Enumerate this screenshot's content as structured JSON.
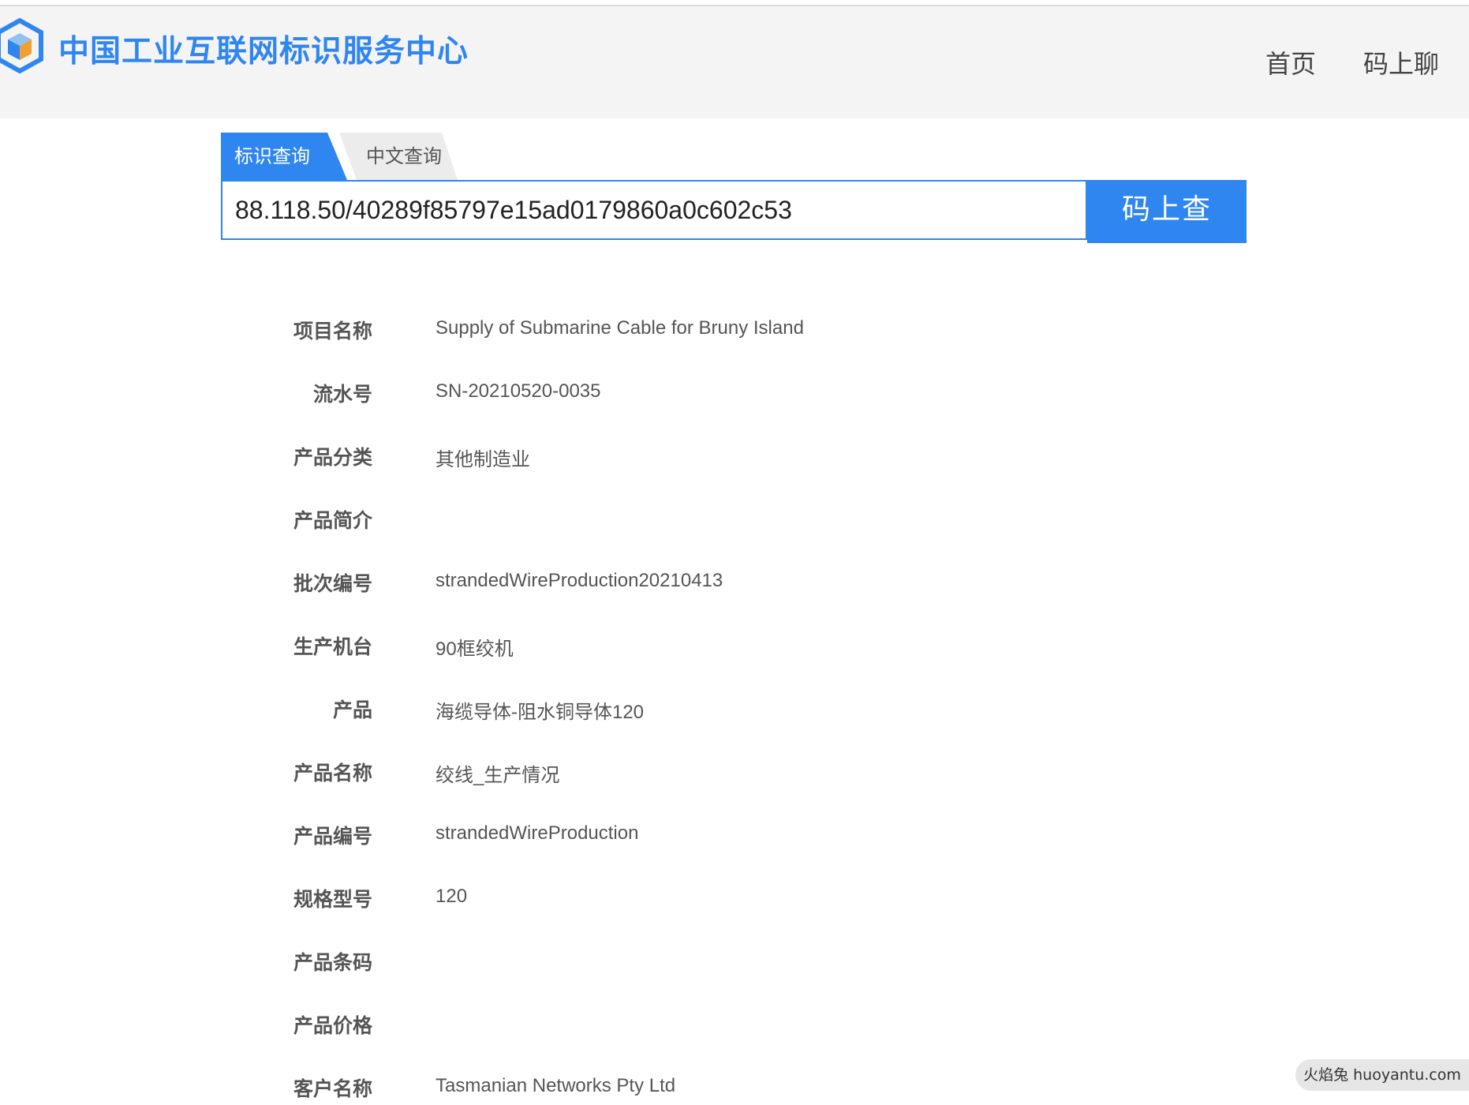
{
  "header": {
    "title": "中国工业互联网标识服务中心",
    "brand_color": "#2f86f0",
    "logo_icon": "cube-logo-icon",
    "nav": [
      {
        "label": "首页"
      },
      {
        "label": "码上聊"
      }
    ]
  },
  "search": {
    "tabs": [
      {
        "label": "标识查询",
        "active": true
      },
      {
        "label": "中文查询",
        "active": false
      }
    ],
    "value": "88.118.50/40289f85797e15ad0179860a0c602c53",
    "button_label": "码上查"
  },
  "details": [
    {
      "label": "项目名称",
      "value": "Supply of Submarine Cable for Bruny Island"
    },
    {
      "label": "流水号",
      "value": "SN-20210520-0035"
    },
    {
      "label": "产品分类",
      "value": "其他制造业"
    },
    {
      "label": "产品简介",
      "value": ""
    },
    {
      "label": "批次编号",
      "value": "strandedWireProduction20210413"
    },
    {
      "label": "生产机台",
      "value": "90框绞机"
    },
    {
      "label": "产品",
      "value": "海缆导体-阻水铜导体120"
    },
    {
      "label": "产品名称",
      "value": "绞线_生产情况"
    },
    {
      "label": "产品编号",
      "value": "strandedWireProduction"
    },
    {
      "label": "规格型号",
      "value": "120"
    },
    {
      "label": "产品条码",
      "value": ""
    },
    {
      "label": "产品价格",
      "value": ""
    },
    {
      "label": "客户名称",
      "value": "Tasmanian Networks Pty Ltd"
    }
  ],
  "watermark": "火焰兔 huoyantu.com"
}
